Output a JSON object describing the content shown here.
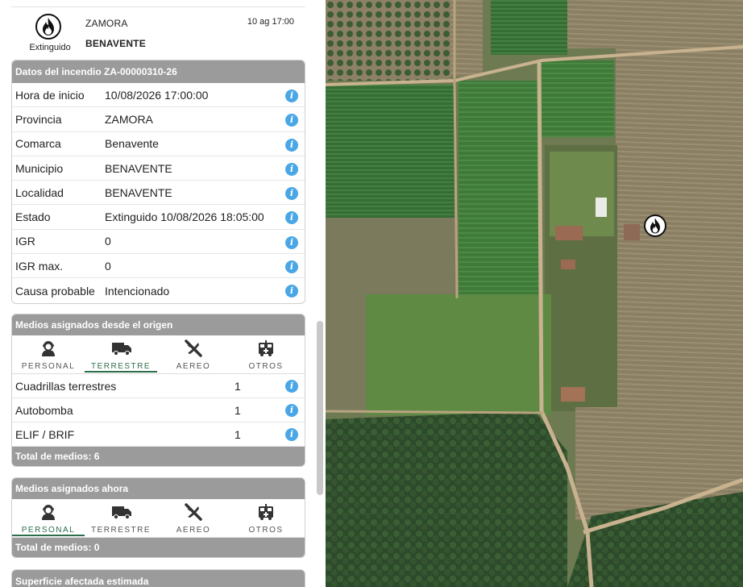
{
  "header": {
    "status": "Extinguido",
    "province": "ZAMORA",
    "municipality": "BENAVENTE",
    "date": "10 ag 17:00"
  },
  "details": {
    "title": "Datos del incendio ZA-00000310-26",
    "rows": [
      {
        "label": "Hora de inicio",
        "value": "10/08/2026 17:00:00"
      },
      {
        "label": "Provincia",
        "value": "ZAMORA"
      },
      {
        "label": "Comarca",
        "value": "Benavente"
      },
      {
        "label": "Municipio",
        "value": "BENAVENTE"
      },
      {
        "label": "Localidad",
        "value": "BENAVENTE"
      },
      {
        "label": "Estado",
        "value": "Extinguido 10/08/2026 18:05:00"
      },
      {
        "label": "IGR",
        "value": "0"
      },
      {
        "label": "IGR max.",
        "value": "0"
      },
      {
        "label": "Causa probable",
        "value": "Intencionado"
      }
    ],
    "info_glyph": "i"
  },
  "origin_resources": {
    "title": "Medios asignados desde el origen",
    "tabs": [
      {
        "label": "PERSONAL",
        "icon": "person-icon"
      },
      {
        "label": "TERRESTRE",
        "icon": "truck-icon"
      },
      {
        "label": "AEREO",
        "icon": "plane-icon"
      },
      {
        "label": "OTROS",
        "icon": "ambulance-icon"
      }
    ],
    "active_tab": "TERRESTRE",
    "rows": [
      {
        "name": "Cuadrillas terrestres",
        "count": "1"
      },
      {
        "name": "Autobomba",
        "count": "1"
      },
      {
        "name": "ELIF / BRIF",
        "count": "1"
      }
    ],
    "total": "Total de medios: 6"
  },
  "current_resources": {
    "title": "Medios asignados ahora",
    "tabs": [
      {
        "label": "PERSONAL",
        "icon": "person-icon"
      },
      {
        "label": "TERRESTRE",
        "icon": "truck-icon"
      },
      {
        "label": "AEREO",
        "icon": "plane-icon"
      },
      {
        "label": "OTROS",
        "icon": "ambulance-icon"
      }
    ],
    "active_tab": "PERSONAL",
    "total": "Total de medios: 0"
  },
  "surface": {
    "title": "Superficie afectada estimada"
  },
  "colors": {
    "panel_header": "#9b9b9b",
    "info_blue": "#4aa7e6",
    "active_tab": "#2c6e49"
  }
}
